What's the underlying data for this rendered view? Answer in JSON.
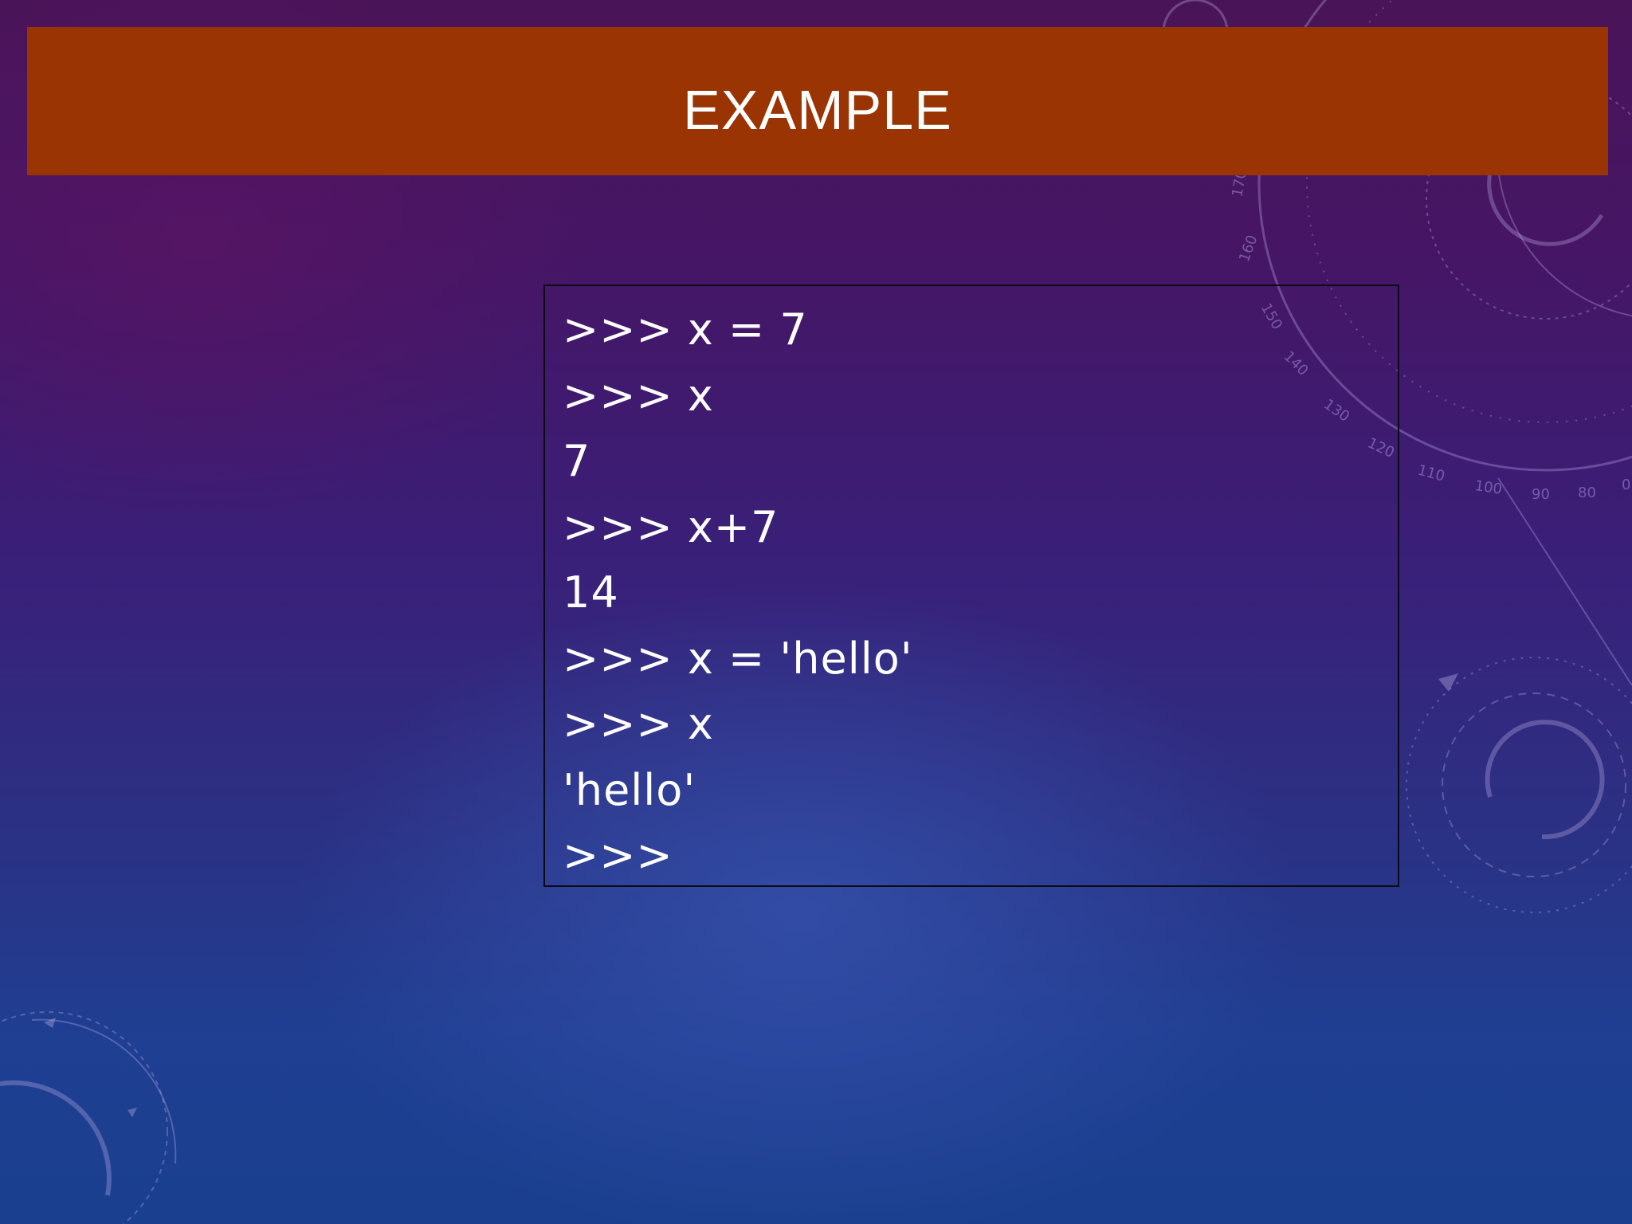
{
  "slide": {
    "title": "EXAMPLE"
  },
  "code_block": {
    "lines": [
      ">>> x = 7",
      ">>> x",
      "7",
      ">>> x+7",
      "14",
      ">>> x = 'hello'",
      ">>> x",
      "'hello'",
      ">>>"
    ]
  },
  "decoration": {
    "dial_numbers": [
      "170",
      "160",
      "150",
      "140",
      "130",
      "120",
      "110",
      "100",
      "90",
      "80",
      "0"
    ]
  },
  "colors": {
    "title_bar": "#9a3402",
    "text": "#ffffff",
    "code_border": "#0b0b14"
  }
}
